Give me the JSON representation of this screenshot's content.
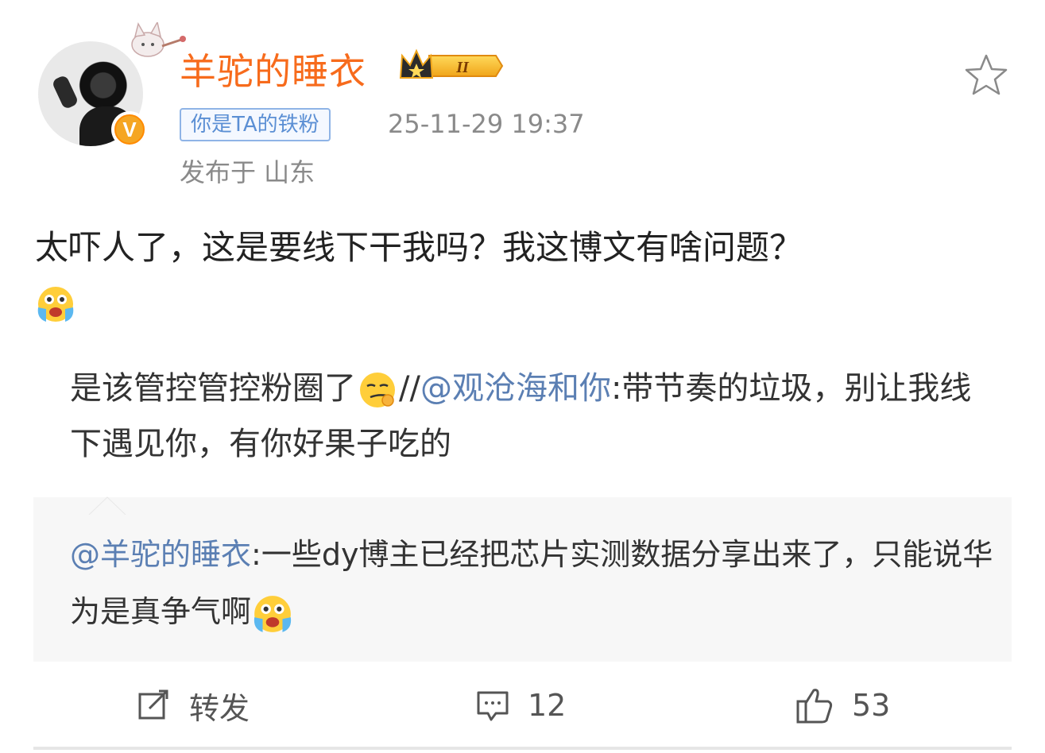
{
  "post": {
    "username": "羊驼的睡衣",
    "vip_level": "II",
    "fan_badge": "你是TA的铁粉",
    "timestamp": "25-11-29 19:37",
    "location": "发布于 山东",
    "text": "太吓人了，这是要线下干我吗？我这博文有啥问题？",
    "verified_mark": "V"
  },
  "repost_chain": {
    "comment": "是该管控管控粉圈了",
    "separator": "//",
    "mention": "@观沧海和你",
    "mention_text": ":带节奏的垃圾，别让我线下遇见你，有你好果子吃的"
  },
  "quoted": {
    "mention": "@羊驼的睡衣",
    "text": ":一些dy博主已经把芯片实测数据分享出来了，只能说华为是真争气啊"
  },
  "actions": {
    "forward_label": "转发",
    "comment_count": "12",
    "like_count": "53"
  },
  "colors": {
    "username": "#f76b1c",
    "mention": "#5b7fb3",
    "badge_border": "#8fb4e6",
    "meta_gray": "#8a8a8a",
    "quote_bg": "#f7f7f7"
  },
  "icons": [
    "star-icon",
    "verified-icon",
    "crown-icon",
    "crying-emoji",
    "smirk-emoji",
    "forward-icon",
    "comment-icon",
    "thumbs-up-icon"
  ]
}
